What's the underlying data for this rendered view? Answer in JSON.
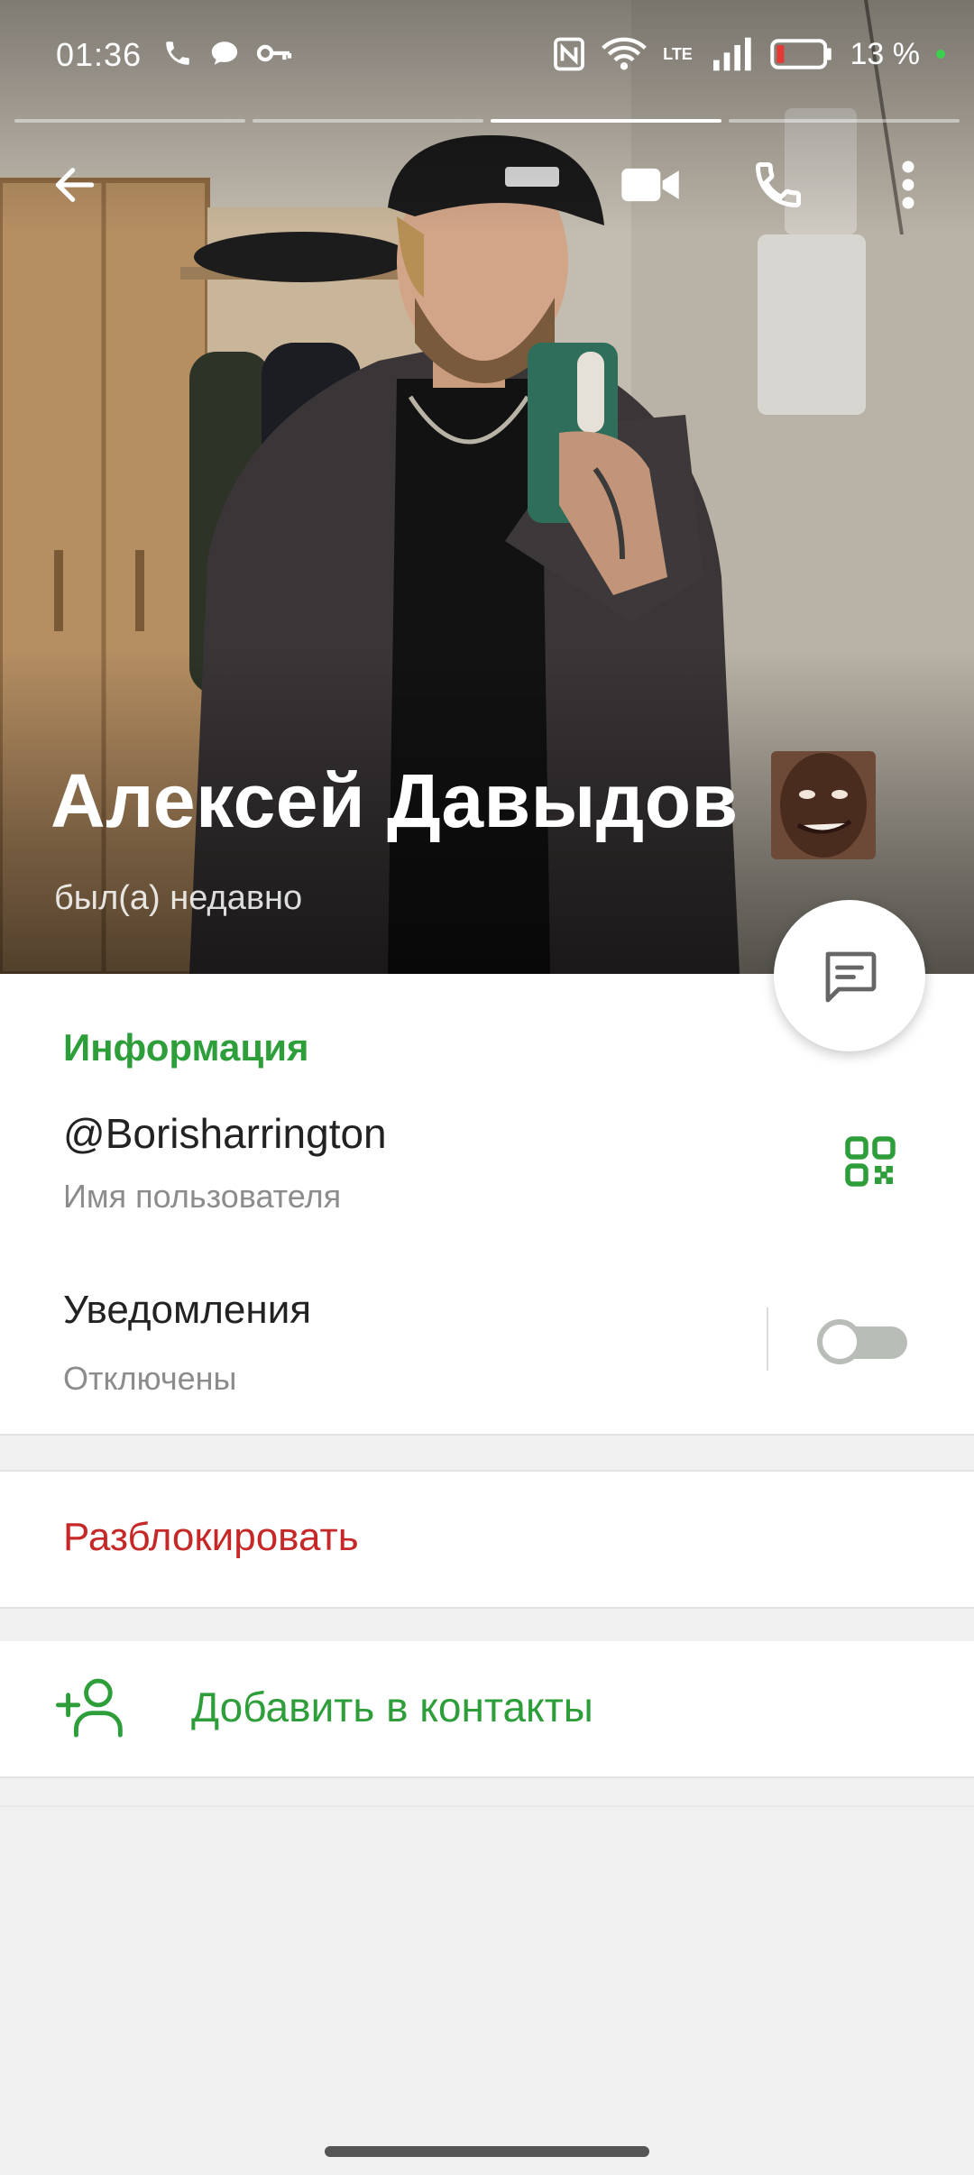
{
  "status_bar": {
    "time": "01:36",
    "network": "LTE",
    "battery": "13 %"
  },
  "stories": {
    "total": 4,
    "active_index": 2
  },
  "profile": {
    "name": "Алексей Давыдов",
    "status": "был(а) недавно"
  },
  "info": {
    "section_title": "Информация",
    "username": "@Borisharrington",
    "username_label": "Имя пользователя",
    "notifications_title": "Уведомления",
    "notifications_state": "Отключены",
    "notifications_enabled": false
  },
  "actions": {
    "unblock": "Разблокировать",
    "add_contact": "Добавить в контакты"
  },
  "colors": {
    "accent_green": "#2e9e3a",
    "danger_red": "#c62828",
    "background": "#f0f0f0"
  },
  "icons": [
    "back-arrow-icon",
    "video-call-icon",
    "phone-icon",
    "more-vert-icon",
    "message-icon",
    "qr-code-icon",
    "add-person-icon"
  ]
}
